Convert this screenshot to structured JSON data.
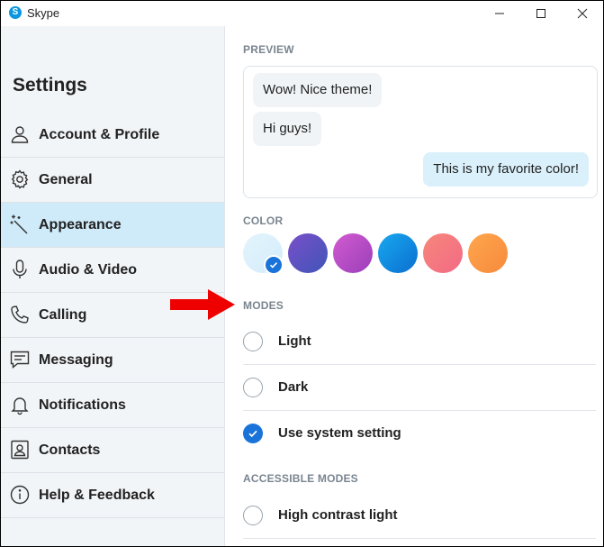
{
  "window": {
    "title": "Skype",
    "logo_letter": "S"
  },
  "sidebar": {
    "title": "Settings",
    "items": [
      {
        "label": "Account & Profile",
        "icon": "person-icon"
      },
      {
        "label": "General",
        "icon": "gear-icon"
      },
      {
        "label": "Appearance",
        "icon": "magic-wand-icon",
        "active": true
      },
      {
        "label": "Audio & Video",
        "icon": "microphone-icon"
      },
      {
        "label": "Calling",
        "icon": "phone-icon"
      },
      {
        "label": "Messaging",
        "icon": "chat-icon"
      },
      {
        "label": "Notifications",
        "icon": "bell-icon"
      },
      {
        "label": "Contacts",
        "icon": "contacts-icon"
      },
      {
        "label": "Help & Feedback",
        "icon": "info-icon"
      }
    ]
  },
  "preview": {
    "label": "PREVIEW",
    "messages": [
      {
        "text": "Wow! Nice theme!",
        "direction": "incoming"
      },
      {
        "text": "Hi guys!",
        "direction": "incoming"
      },
      {
        "text": "This is my favorite color!",
        "direction": "outgoing"
      }
    ]
  },
  "color": {
    "label": "COLOR",
    "swatches": [
      {
        "name": "light-blue",
        "colors": [
          "#e3f4fd",
          "#d3ecfa"
        ],
        "selected": true
      },
      {
        "name": "indigo",
        "colors": [
          "#7a4fc9",
          "#3f55b8"
        ]
      },
      {
        "name": "magenta",
        "colors": [
          "#d35bd0",
          "#9a3fba"
        ]
      },
      {
        "name": "blue",
        "colors": [
          "#19a8ef",
          "#0a6fd0"
        ]
      },
      {
        "name": "coral",
        "colors": [
          "#f7877a",
          "#f26a86"
        ]
      },
      {
        "name": "orange",
        "colors": [
          "#ffa64d",
          "#f68a3c"
        ]
      }
    ]
  },
  "modes": {
    "label": "MODES",
    "options": [
      {
        "label": "Light",
        "checked": false
      },
      {
        "label": "Dark",
        "checked": false
      },
      {
        "label": "Use system setting",
        "checked": true
      }
    ]
  },
  "accessible_modes": {
    "label": "ACCESSIBLE MODES",
    "options": [
      {
        "label": "High contrast light",
        "checked": false
      }
    ]
  },
  "colors": {
    "accent": "#1a73d9",
    "active_nav": "#cfeaf8",
    "annotation_arrow": "#ee0000"
  }
}
